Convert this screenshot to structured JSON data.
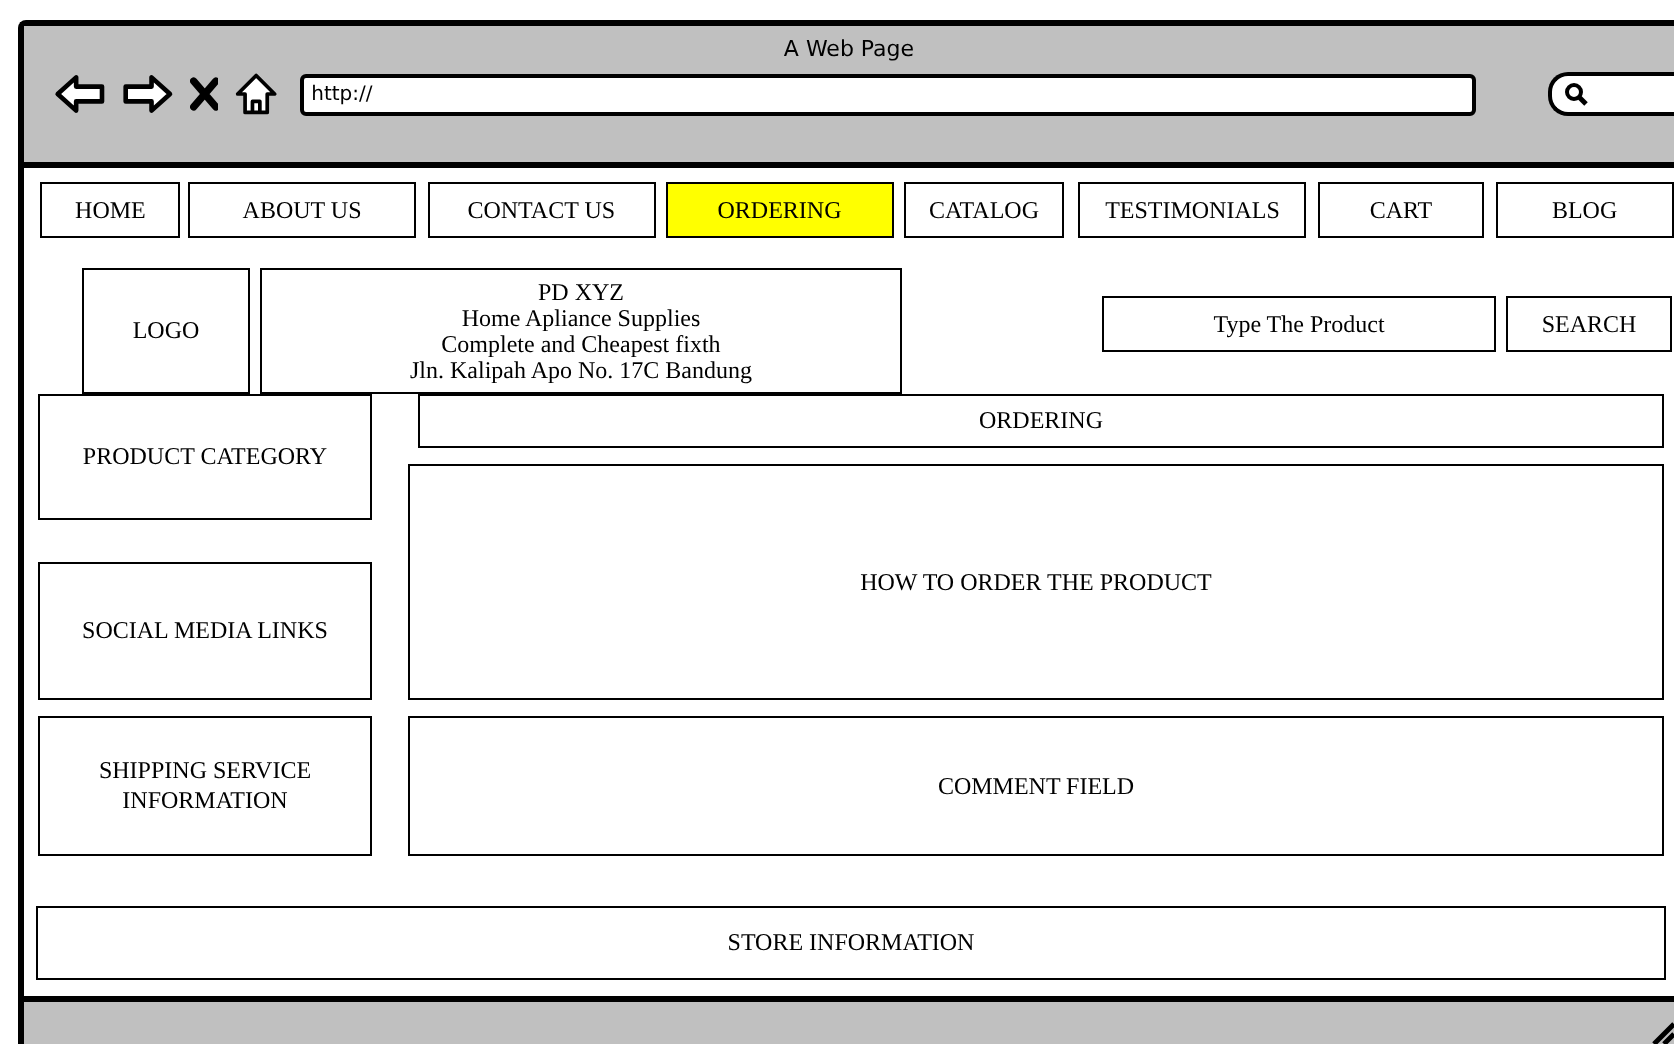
{
  "window": {
    "title": "A Web Page",
    "url": "http://"
  },
  "nav": [
    {
      "label": "HOME",
      "selected": false
    },
    {
      "label": "ABOUT US",
      "selected": false
    },
    {
      "label": "CONTACT US",
      "selected": false
    },
    {
      "label": "ORDERING",
      "selected": true
    },
    {
      "label": "CATALOG",
      "selected": false
    },
    {
      "label": "TESTIMONIALS",
      "selected": false
    },
    {
      "label": "CART",
      "selected": false
    },
    {
      "label": "BLOG",
      "selected": false
    }
  ],
  "header": {
    "logo": "LOGO",
    "store_lines": [
      "PD XYZ",
      "Home Apliance Supplies",
      "Complete and Cheapest fixth",
      "Jln. Kalipah Apo No. 17C Bandung"
    ],
    "search_placeholder": "Type The Product",
    "search_button": "SEARCH"
  },
  "sidebar": [
    "PRODUCT CATEGORY",
    "SOCIAL MEDIA LINKS",
    "SHIPPING SERVICE INFORMATION"
  ],
  "main": {
    "title": "ORDERING",
    "how_to": "HOW TO ORDER THE PRODUCT",
    "comment": "COMMENT FIELD"
  },
  "footer": "STORE INFORMATION"
}
